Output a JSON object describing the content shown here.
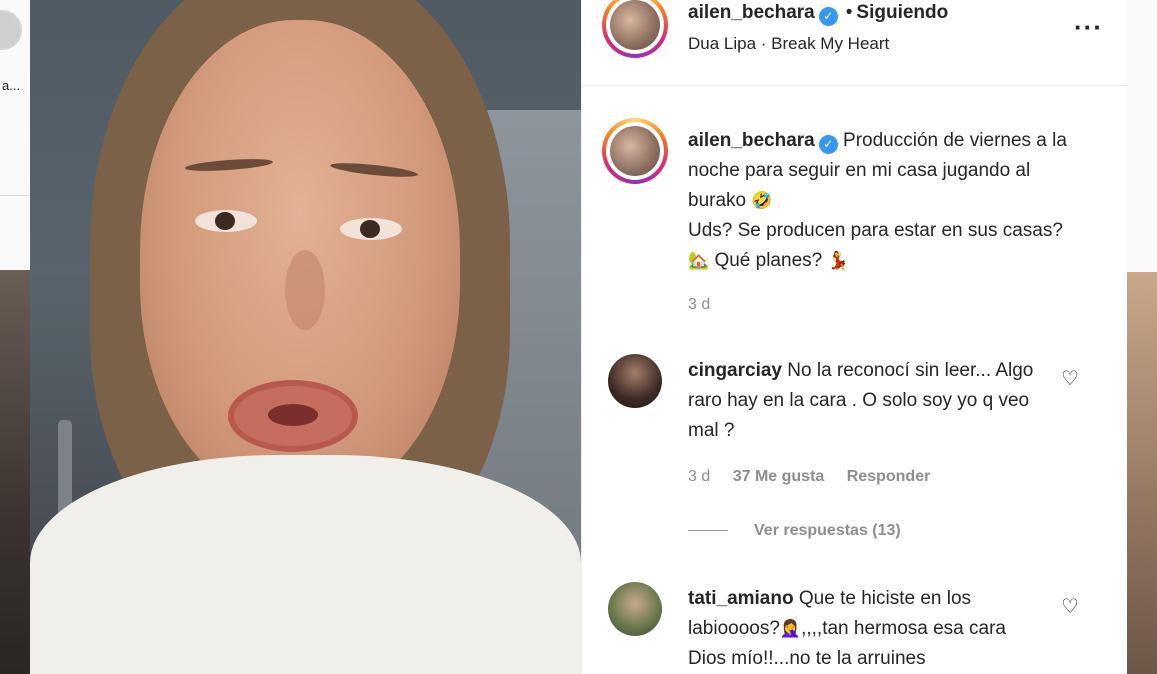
{
  "background_left": {
    "text": "a..."
  },
  "header": {
    "username": "ailen_bechara",
    "separator": "•",
    "follow_status": "Siguiendo",
    "audio": "Dua Lipa · Break My Heart",
    "more_icon": "more-horizontal-icon"
  },
  "caption": {
    "username": "ailen_bechara",
    "line1": "Producción de viernes a la noche para seguir en mi casa jugando al burako",
    "emoji1": "🤣",
    "line2": "Uds? Se producen para estar en sus casas?",
    "emoji2": "🏡",
    "line3": "Qué planes?",
    "emoji3": "💃",
    "time": "3 d"
  },
  "comments": [
    {
      "username": "cingarciay",
      "text": "No la reconocí sin leer... Algo raro hay en la cara . O solo soy yo q veo mal ?",
      "time": "3 d",
      "likes": "37 Me gusta",
      "reply": "Responder",
      "view_replies": "Ver respuestas (13)"
    },
    {
      "username": "tati_amiano",
      "text_a": "Que te hiciste en los labioooos?",
      "emoji": "🤦‍♀️",
      "text_b": ",,,,tan hermosa esa cara Dios mío!!...no te la arruines"
    }
  ],
  "colors": {
    "text": "#262626",
    "secondary": "#8e8e8e",
    "verified": "#3897f0",
    "border": "#efefef"
  }
}
